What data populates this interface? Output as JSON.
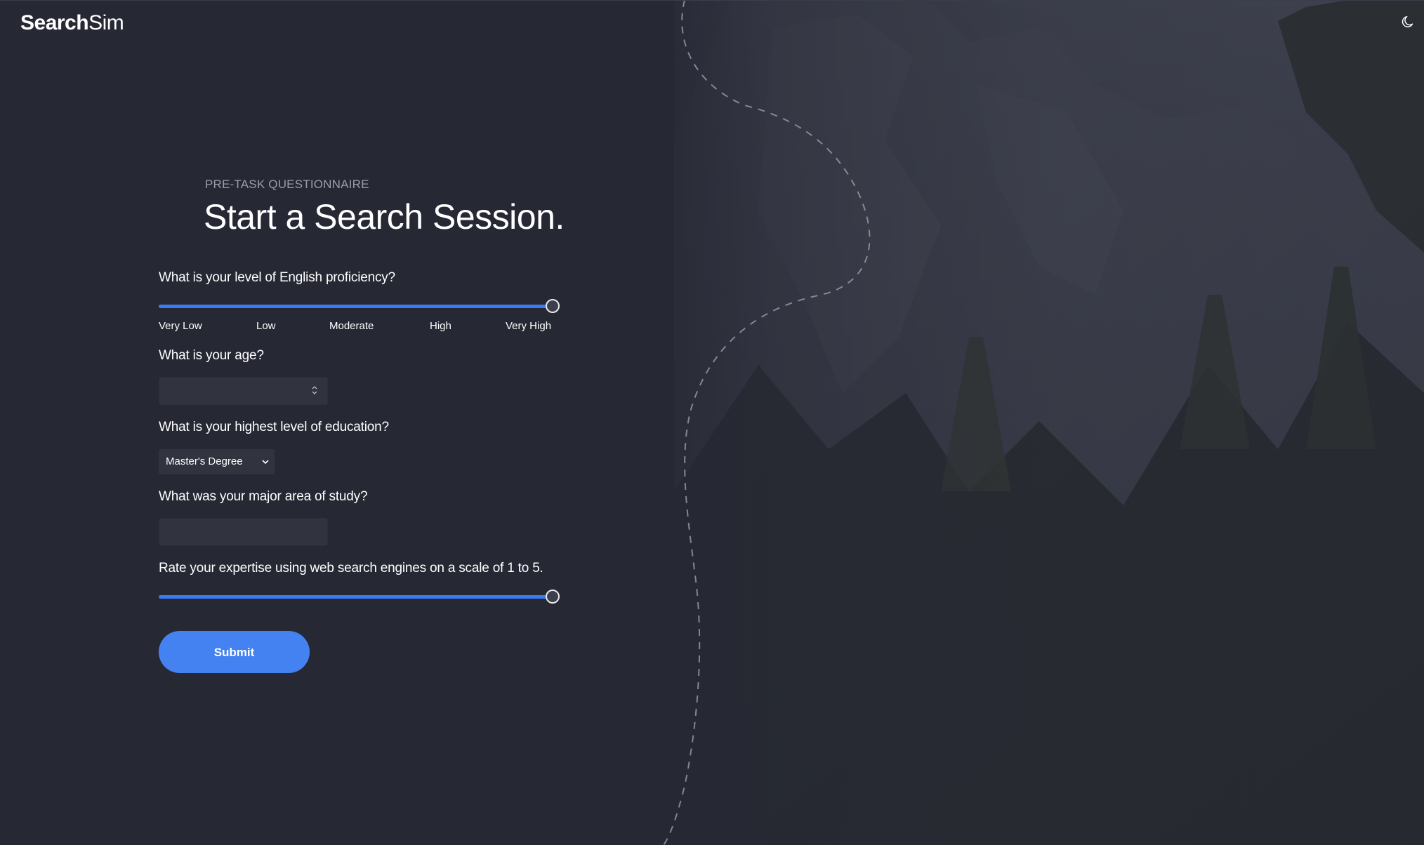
{
  "app": {
    "logo_bold": "Search",
    "logo_regular": "Sim",
    "theme_toggle_icon": "moon-icon"
  },
  "form": {
    "eyebrow": "PRE-TASK QUESTIONNAIRE",
    "title": "Start a Search Session.",
    "english": {
      "question": "What is your level of English proficiency?",
      "value_fraction": 1.0,
      "labels": [
        "Very Low",
        "Low",
        "Moderate",
        "High",
        "Very High"
      ]
    },
    "age": {
      "question": "What is your age?",
      "value": ""
    },
    "education": {
      "question": "What is your highest level of education?",
      "selected": "Master's Degree"
    },
    "major": {
      "question": "What was your major area of study?",
      "value": ""
    },
    "expertise": {
      "question": "Rate your expertise using web search engines on a scale of 1 to 5.",
      "value_fraction": 1.0
    },
    "submit_label": "Submit"
  },
  "colors": {
    "accent": "#3a7cf0",
    "button": "#4382f0",
    "background": "#262834",
    "field": "#31343f"
  }
}
